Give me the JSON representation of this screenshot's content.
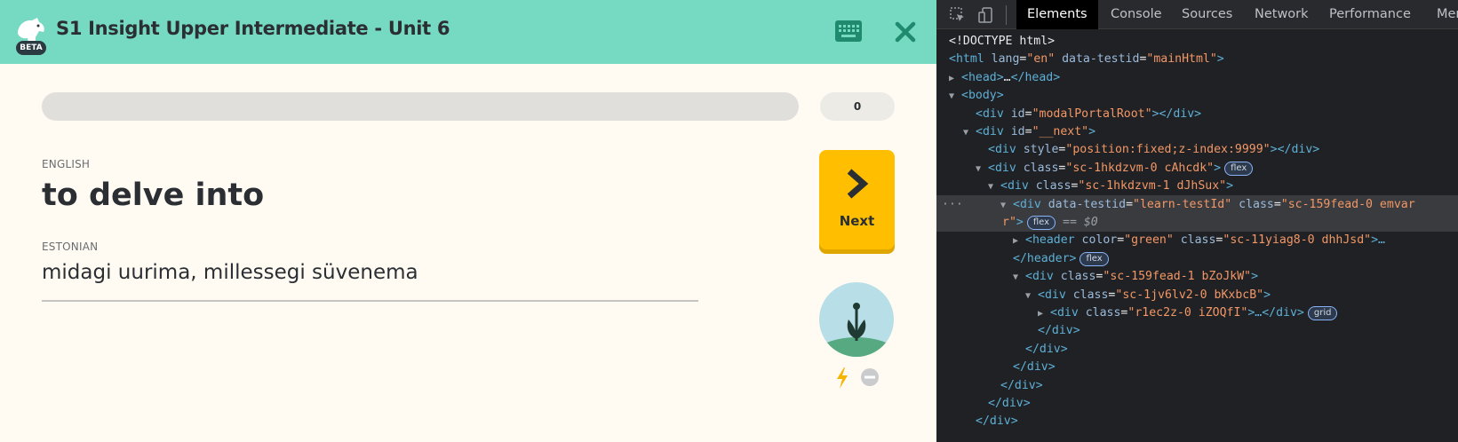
{
  "app": {
    "title": "S1 Insight Upper Intermediate - Unit 6",
    "beta_badge": "BETA",
    "progress_fraction": 0.0,
    "points": "0",
    "prompt_language": "ENGLISH",
    "prompt_word": "to delve into",
    "answer_language": "ESTONIAN",
    "answer_text": "midagi uurima, millessegi süvenema",
    "next_label": "Next",
    "icons": {
      "logo": "bear-logo-icon",
      "keyboard": "keyboard-icon",
      "close": "close-icon",
      "next": "chevron-right-icon",
      "plant": "plant-sprout-icon",
      "bolt": "lightning-bolt-icon",
      "ignore": "minus-circle-icon"
    },
    "colors": {
      "header": "#76d9c2",
      "accent_dark": "#1f8a6e",
      "next_button": "#ffbf00",
      "background": "#fffbf3"
    }
  },
  "devtools": {
    "tabs": [
      "Elements",
      "Console",
      "Sources",
      "Network",
      "Performance",
      "Mem"
    ],
    "active_tab": "Elements",
    "dom_lines": [
      {
        "text": "<!DOCTYPE html>"
      },
      {
        "tag_open": "<html",
        "attrs": [
          [
            "lang",
            "\"en\""
          ],
          [
            "data-testid",
            "\"mainHtml\""
          ]
        ],
        "tail": ">"
      },
      {
        "tri": "▶",
        "tag_open": "<head>",
        "mid": "…",
        "tag_close": "</head>"
      },
      {
        "tri": "▼",
        "tag_open": "<body>"
      },
      {
        "tag_open": "<div",
        "attrs": [
          [
            "id",
            "\"modalPortalRoot\""
          ]
        ],
        "tail": "></div>"
      },
      {
        "tri": "▼",
        "tag_open": "<div",
        "attrs": [
          [
            "id",
            "\"__next\""
          ]
        ],
        "tail": ">"
      },
      {
        "tag_open": "<div",
        "attrs": [
          [
            "style",
            "\"position:fixed;z-index:9999\""
          ]
        ],
        "tail": "></div>"
      },
      {
        "tri": "▼",
        "tag_open": "<div",
        "attrs": [
          [
            "class",
            "\"sc-1hkdzvm-0 cAhcdk\""
          ]
        ],
        "tail": ">",
        "badge": "flex"
      },
      {
        "tri": "▼",
        "tag_open": "<div",
        "attrs": [
          [
            "class",
            "\"sc-1hkdzvm-1 dJhSux\""
          ]
        ],
        "tail": ">"
      },
      {
        "tri": "▼",
        "tag_open": "<div",
        "attrs": [
          [
            "data-testid",
            "\"learn-testId\""
          ],
          [
            "class",
            "\"sc-159fead-0 emvar"
          ]
        ],
        "selected": true
      },
      {
        "cont": "r\"",
        "tail": ">",
        "badge": "flex",
        "dollar": "== $0",
        "selected": true
      },
      {
        "tri": "▶",
        "tag_open": "<header",
        "attrs": [
          [
            "color",
            "\"green\""
          ],
          [
            "class",
            "\"sc-11yiag8-0 dhhJsd\""
          ]
        ],
        "tail": ">…"
      },
      {
        "tag_close": "</header>",
        "badge": "flex"
      },
      {
        "tri": "▼",
        "tag_open": "<div",
        "attrs": [
          [
            "class",
            "\"sc-159fead-1 bZoJkW\""
          ]
        ],
        "tail": ">"
      },
      {
        "tri": "▼",
        "tag_open": "<div",
        "attrs": [
          [
            "class",
            "\"sc-1jv6lv2-0 bKxbcB\""
          ]
        ],
        "tail": ">"
      },
      {
        "tri": "▶",
        "tag_open": "<div",
        "attrs": [
          [
            "class",
            "\"r1ec2z-0 iZOQfI\""
          ]
        ],
        "tail": ">…</div>",
        "badge": "grid"
      },
      {
        "tag_close": "</div>"
      },
      {
        "tag_close": "</div>"
      },
      {
        "tag_close": "</div>"
      },
      {
        "tag_close": "</div>"
      },
      {
        "tag_close": "</div>"
      },
      {
        "tag_close": "</div>"
      }
    ]
  }
}
